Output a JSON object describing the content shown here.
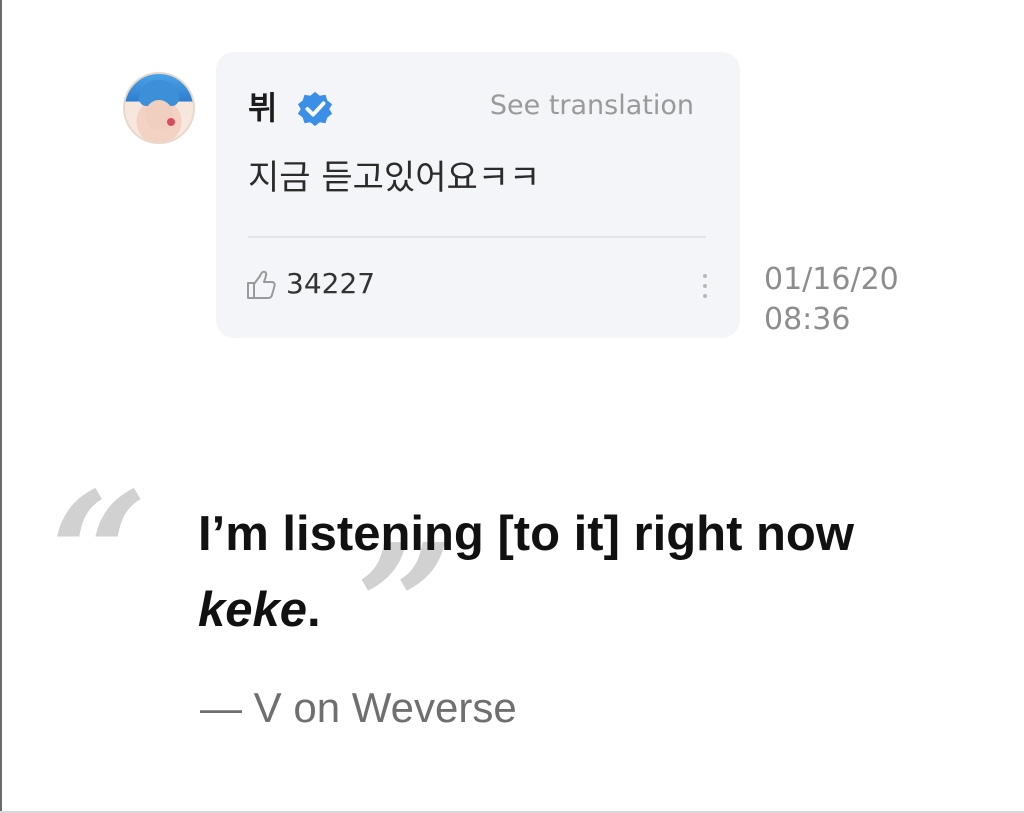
{
  "comment": {
    "username": "뷔",
    "verified_icon": "verified-check-icon",
    "see_translation": "See translation",
    "text": "지금 듣고있어요ㅋㅋ",
    "like_icon": "thumbs-up-icon",
    "like_count": "34227",
    "more_icon": "vertical-ellipsis-icon",
    "timestamp_date": "01/16/20",
    "timestamp_time": "08:36"
  },
  "quote": {
    "open_mark": "“",
    "close_mark": "”",
    "line1": "I’m listening [to it] right now",
    "line2_italic": "keke",
    "line2_end": ".",
    "attribution": "— V on Weverse"
  },
  "colors": {
    "card_background": "#f4f5f8",
    "verified_blue": "#3b8fe6",
    "quote_mark_gray": "#d1d1d1",
    "muted_text": "#9a9a9a"
  }
}
